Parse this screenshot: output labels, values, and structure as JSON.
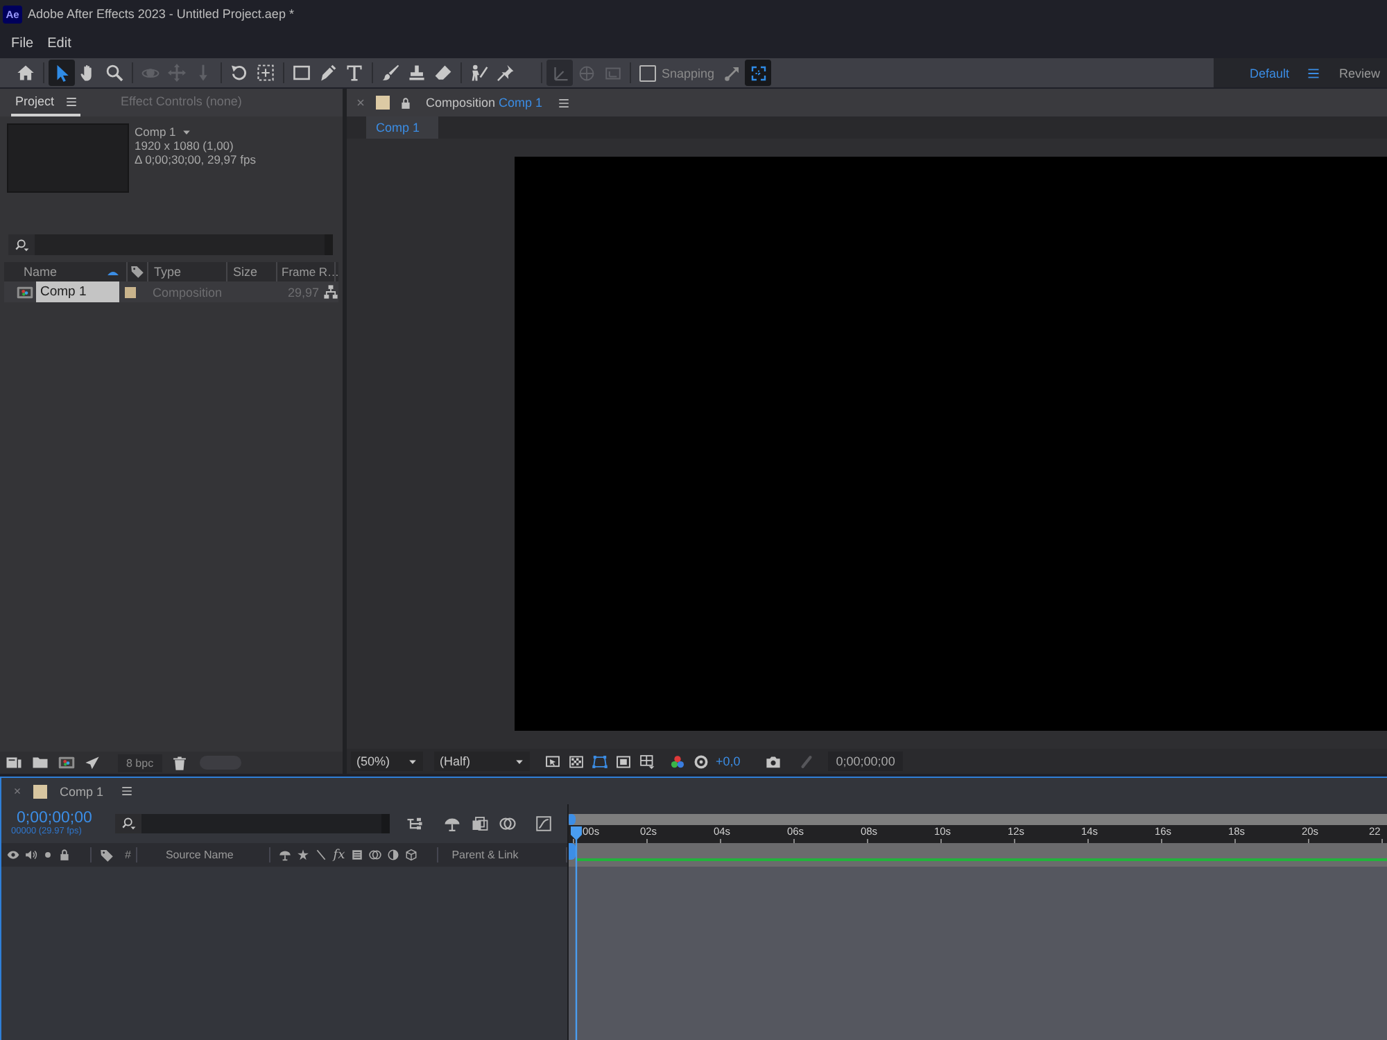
{
  "window": {
    "app_logo": "Ae",
    "title": "Adobe After Effects 2023 - Untitled Project.aep *"
  },
  "menu_bar": [
    "File",
    "Edit"
  ],
  "toolbar": {
    "tool_groups": [
      [
        {
          "selected": false,
          "disabled": false
        }
      ],
      [
        {
          "selected": true,
          "disabled": false
        },
        {
          "selected": false,
          "disabled": false
        },
        {
          "selected": false,
          "disabled": false
        }
      ],
      [
        {
          "selected": false,
          "disabled": true
        },
        {
          "selected": false,
          "disabled": true
        },
        {
          "selected": false,
          "disabled": true
        }
      ],
      [
        {
          "selected": false,
          "disabled": false
        },
        {
          "selected": false,
          "disabled": false
        }
      ],
      [
        {
          "selected": false,
          "disabled": false
        },
        {
          "selected": false,
          "disabled": false
        },
        {
          "selected": false,
          "disabled": false
        }
      ],
      [
        {
          "selected": false,
          "disabled": false
        },
        {
          "selected": false,
          "disabled": false
        },
        {
          "selected": false,
          "disabled": false
        }
      ],
      [
        {
          "selected": false,
          "disabled": false
        },
        {
          "selected": false,
          "disabled": false
        }
      ]
    ],
    "axis_modes": [
      {
        "selected": true
      },
      {
        "selected": false
      },
      {
        "selected": false
      }
    ],
    "snapping": {
      "label": "Snapping",
      "checked": false
    },
    "snap_toggles": [
      {
        "on": false
      },
      {
        "on": true
      }
    ],
    "workspaces": [
      {
        "label": "Default",
        "selected": true
      },
      {
        "label": "Review",
        "selected": false
      }
    ]
  },
  "project_panel": {
    "tabs": [
      {
        "label": "Project",
        "selected": true
      },
      {
        "label": "Effect Controls (none)",
        "selected": false
      }
    ],
    "preview": {
      "name": "Comp 1",
      "dimensions": "1920 x 1080 (1,00)",
      "duration": "Δ 0;00;30;00, 29,97 fps"
    },
    "columns": {
      "name": "Name",
      "type": "Type",
      "size": "Size",
      "frame_rate": "Frame R…"
    },
    "items": [
      {
        "name": "Comp 1",
        "type": "Composition",
        "frame_rate": "29,97",
        "selected": true,
        "color": "#c9b48c"
      }
    ],
    "footer": {
      "bit_depth": "8 bpc"
    }
  },
  "composition_panel": {
    "tab": {
      "label": "Composition",
      "name": "Comp 1",
      "color": "#dccaa4"
    },
    "viewer_tabs": [
      {
        "label": "Comp 1",
        "selected": true
      }
    ],
    "footer": {
      "magnification": "(50%)",
      "resolution": "(Half)",
      "view_toggles": [
        {
          "on": false
        },
        {
          "on": false
        },
        {
          "on": true
        },
        {
          "on": false
        },
        {
          "on": false
        }
      ],
      "exposure": "+0,0",
      "timecode": "0;00;00;00"
    }
  },
  "timeline_panel": {
    "tab": {
      "label": "Comp 1",
      "color": "#d8c6a0"
    },
    "timecode": "0;00;00;00",
    "frame_info": "00000 (29.97 fps)",
    "columns": {
      "number": "#",
      "source_name": "Source Name",
      "fx": "fx",
      "parent": "Parent & Link"
    },
    "ruler": [
      "00s",
      "02s",
      "04s",
      "06s",
      "08s",
      "10s",
      "12s",
      "14s",
      "16s",
      "18s",
      "20s",
      "22"
    ]
  }
}
